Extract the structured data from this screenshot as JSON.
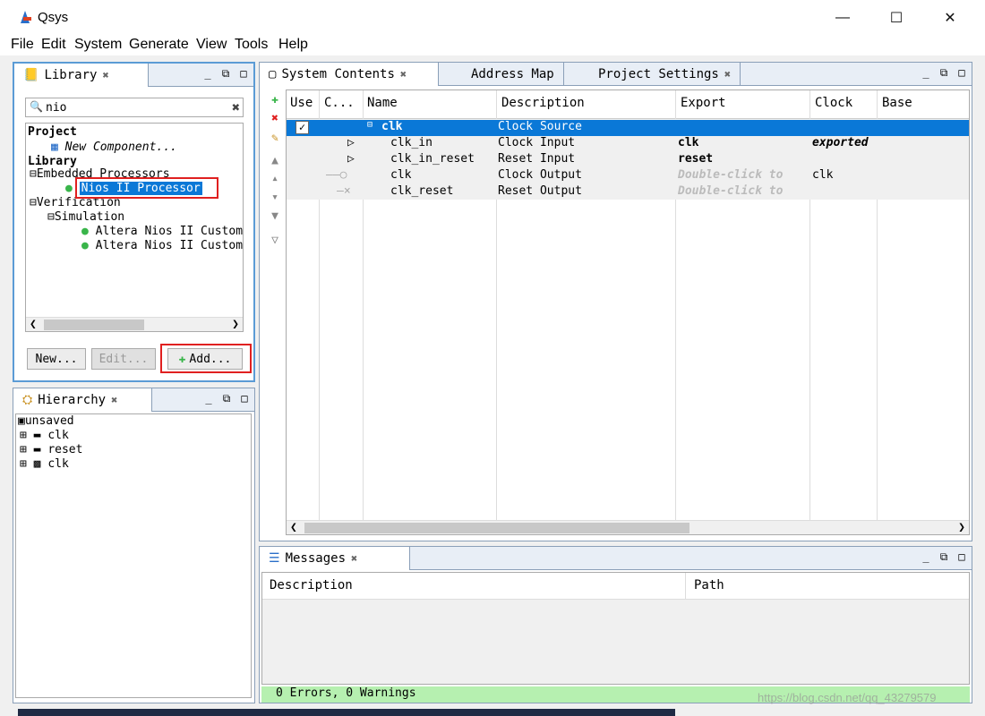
{
  "window": {
    "title": "Qsys"
  },
  "menu": [
    "File",
    "Edit",
    "System",
    "Generate",
    "View",
    "Tools",
    "Help"
  ],
  "library": {
    "tab": "Library",
    "search_value": "nio",
    "tree": {
      "project_label": "Project",
      "new_component": "New Component...",
      "library_label": "Library",
      "embedded": "Embedded Processors",
      "nios": "Nios II Processor",
      "verification": "Verification",
      "simulation": "Simulation",
      "altera1": "Altera Nios II Custom",
      "altera2": "Altera Nios II Custom"
    },
    "buttons": {
      "new": "New...",
      "edit": "Edit...",
      "add": "Add..."
    }
  },
  "hierarchy": {
    "tab": "Hierarchy",
    "root": "unsaved",
    "items": [
      "clk",
      "reset",
      "clk"
    ]
  },
  "system": {
    "tabs": [
      "System Contents",
      "Address Map",
      "Project Settings"
    ],
    "columns": [
      "Use",
      "C...",
      "Name",
      "Description",
      "Export",
      "Clock",
      "Base"
    ],
    "rows": [
      {
        "name": "clk",
        "desc": "Clock Source",
        "export": "",
        "clock": ""
      },
      {
        "name": "clk_in",
        "desc": "Clock Input",
        "export": "clk",
        "clock": "exported"
      },
      {
        "name": "clk_in_reset",
        "desc": "Reset Input",
        "export": "reset",
        "clock": ""
      },
      {
        "name": "clk",
        "desc": "Clock Output",
        "export": "Double-click to",
        "clock": "clk"
      },
      {
        "name": "clk_reset",
        "desc": "Reset Output",
        "export": "Double-click to",
        "clock": ""
      }
    ]
  },
  "messages": {
    "tab": "Messages",
    "columns": [
      "Description",
      "Path"
    ],
    "status": "0 Errors, 0 Warnings"
  },
  "watermark": "https://blog.csdn.net/qq_43279579",
  "colors": {
    "selection": "#0a78d7",
    "status_bg": "#b6f0b0",
    "highlight_box": "#e02020"
  }
}
